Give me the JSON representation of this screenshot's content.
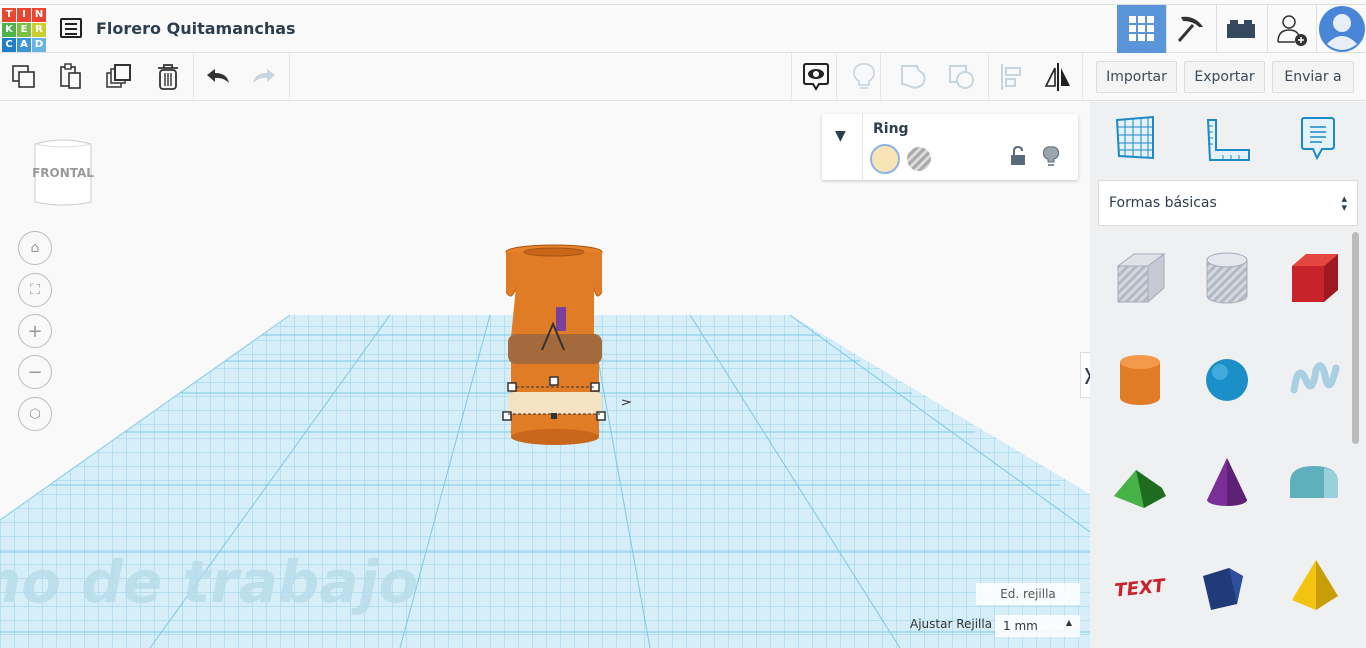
{
  "app": {
    "logo_letters": [
      "T",
      "I",
      "N",
      "K",
      "E",
      "R",
      "C",
      "A",
      "D"
    ],
    "logo_colors": [
      "#e9452f",
      "#e9452f",
      "#e9452f",
      "#4fb34c",
      "#7bc043",
      "#c9cf2e",
      "#1e7ec8",
      "#3d95d5",
      "#67b3e3"
    ],
    "project_title": "Florero Quitamanchas"
  },
  "nav": {
    "items": [
      {
        "icon": "grid-icon",
        "active": true
      },
      {
        "icon": "pickaxe-icon"
      },
      {
        "icon": "bricks-icon"
      },
      {
        "icon": "add-user-icon"
      },
      {
        "icon": "avatar-icon"
      }
    ],
    "accent": "#5b95d9"
  },
  "toolbar": {
    "import_label": "Importar",
    "export_label": "Exportar",
    "send_label": "Enviar a"
  },
  "viewcube": {
    "label": "FRONTAL"
  },
  "inspector": {
    "shape_name": "Ring",
    "solid_color": "#f9e4b7"
  },
  "workplane": {
    "watermark": "no de trabajo",
    "edit_grid_label": "Ed. rejilla",
    "snap_label": "Ajustar Rejilla",
    "snap_value": "1 mm"
  },
  "library": {
    "category": "Formas básicas",
    "shapes": [
      "box-hole",
      "cylinder-hole",
      "box",
      "cylinder",
      "sphere",
      "scribble",
      "roof",
      "cone",
      "round-roof",
      "text",
      "half-cylinder",
      "pyramid"
    ]
  }
}
